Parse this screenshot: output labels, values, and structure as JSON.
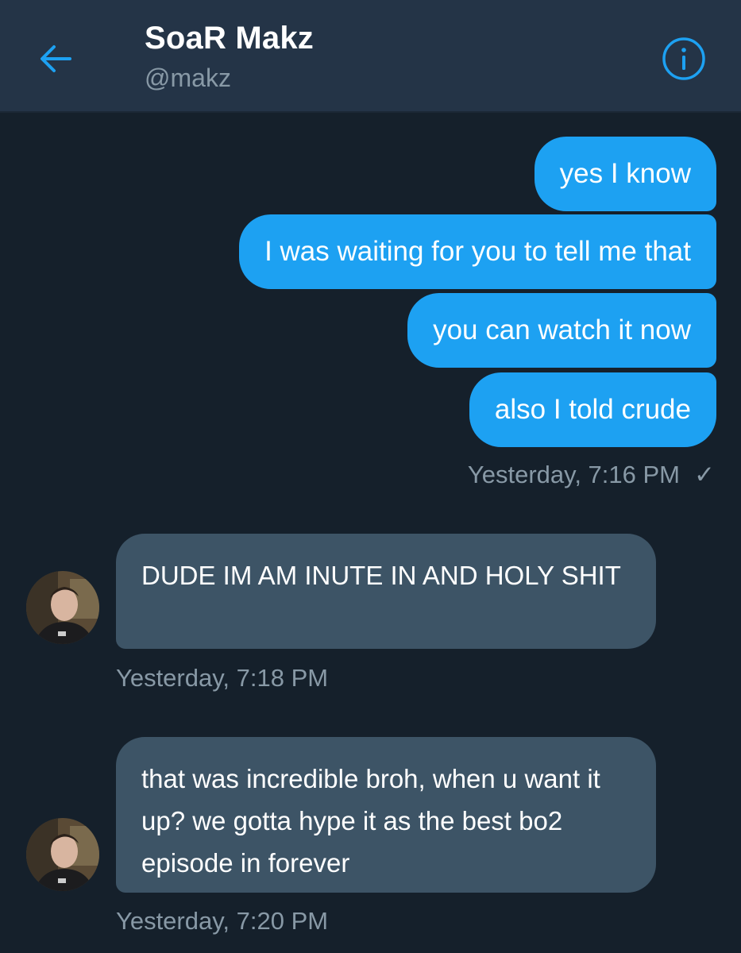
{
  "header": {
    "back_icon": "arrow-left-icon",
    "name": "SoaR Makz",
    "handle": "@makz",
    "info_icon": "info-circle-icon",
    "accent_color": "#1da1f2"
  },
  "outgoing": {
    "messages": [
      "yes I know",
      "I was waiting for you to tell me that",
      "you can watch it now",
      "also I told crude"
    ],
    "timestamp": "Yesterday, 7:16 PM",
    "status_icon": "checkmark-icon",
    "status_glyph": "✓"
  },
  "incoming": [
    {
      "text": "DUDE IM AM INUTE IN AND HOLY SHIT",
      "timestamp": "Yesterday, 7:18 PM"
    },
    {
      "text": "that was incredible broh, when u want it up? we gotta hype it as the best bo2 episode in forever",
      "timestamp": "Yesterday, 7:20 PM"
    }
  ],
  "colors": {
    "background": "#15202b",
    "header": "#243447",
    "outgoing_bubble": "#1da1f2",
    "incoming_bubble": "#3d5466",
    "muted_text": "#8899a6"
  }
}
